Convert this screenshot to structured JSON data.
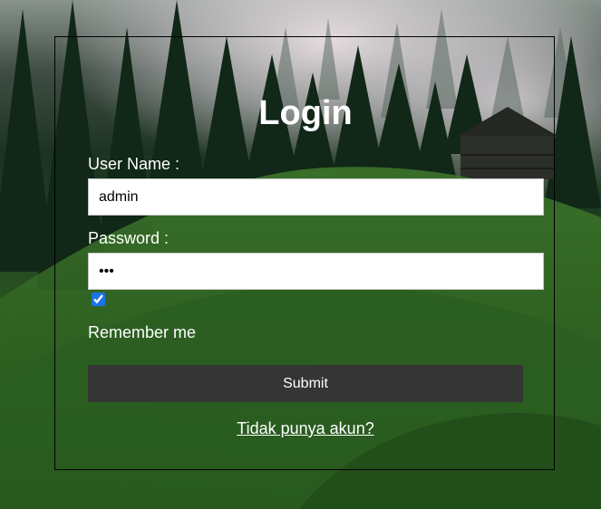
{
  "login": {
    "title": "Login",
    "username_label": "User Name :",
    "username_value": "admin",
    "password_label": "Password :",
    "password_value": "abc",
    "remember_checked": true,
    "remember_label": "Remember me",
    "submit_label": "Submit",
    "signup_link": "Tidak punya akun?"
  },
  "colors": {
    "submit_bg": "#353535",
    "text": "#ffffff",
    "checkbox_accent": "#1a73e8"
  }
}
